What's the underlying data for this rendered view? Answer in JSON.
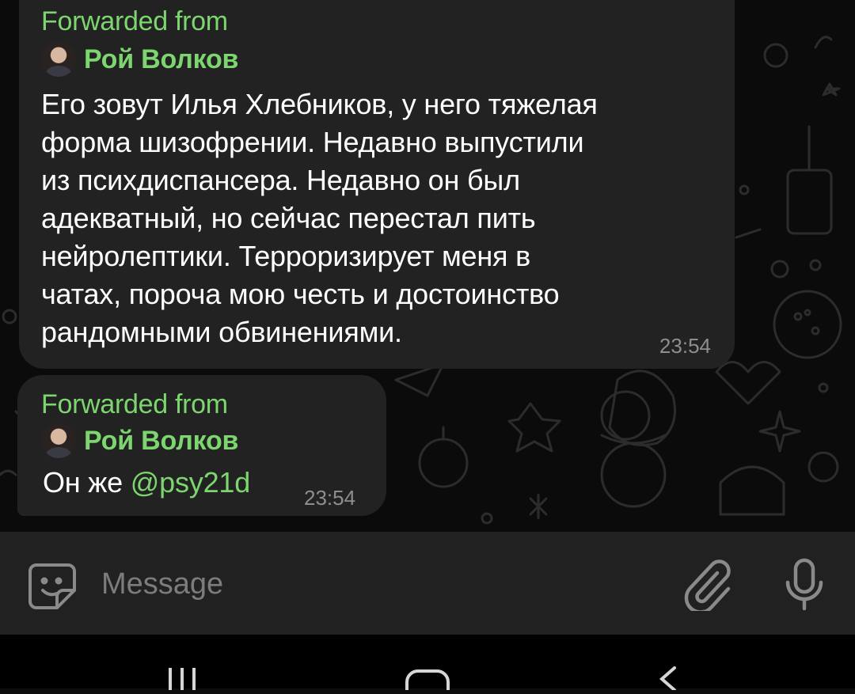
{
  "messages": [
    {
      "forwarded_label": "Forwarded from",
      "sender": "Рой Волков",
      "lines": [
        "Его зовут Илья Хлебников, у него тяжелая",
        "форма шизофрении. Недавно выпустили",
        "из психдиспансера. Недавно он был",
        "адекватный, но сейчас перестал пить",
        "нейролептики. Терроризирует меня в",
        "чатах, пороча мою честь и достоинство",
        "рандомными обвинениями."
      ],
      "time": "23:54"
    },
    {
      "forwarded_label": "Forwarded from",
      "sender": "Рой Волков",
      "text": "Он же ",
      "mention": "@psy21d",
      "time": "23:54"
    }
  ],
  "composer": {
    "placeholder": "Message",
    "emoji_icon": "sticker-icon",
    "attach_icon": "paperclip-icon",
    "mic_icon": "microphone-icon"
  },
  "navbar": {
    "recents_icon": "recent-apps-icon",
    "home_icon": "home-icon",
    "back_icon": "back-icon"
  },
  "colors": {
    "accent_green": "#7dd56f",
    "bubble": "#222222",
    "background": "#0b0b0b",
    "input_bar": "#212121"
  }
}
